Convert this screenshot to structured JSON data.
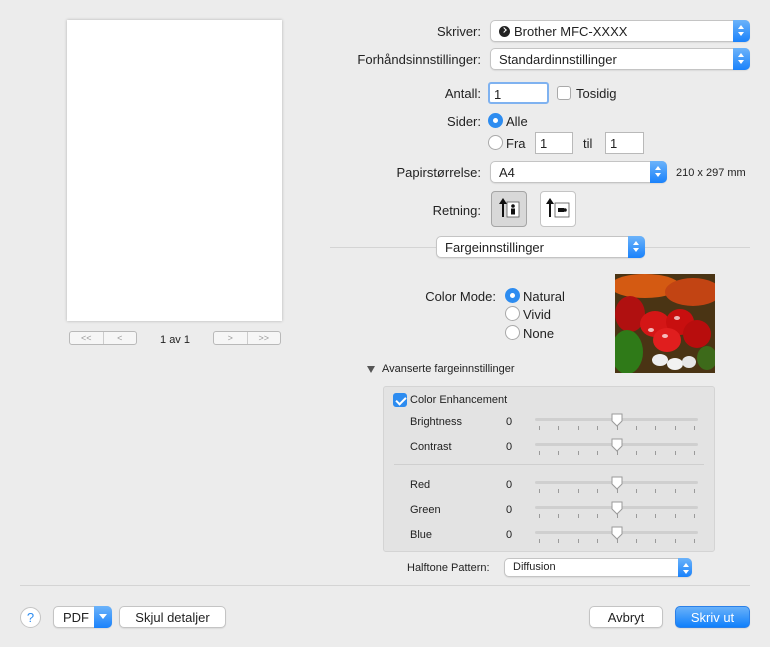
{
  "preview": {
    "page_indicator": "1 av 1",
    "first_label": "<<",
    "prev_label": "<",
    "next_label": ">",
    "last_label": ">>"
  },
  "printer": {
    "label": "Skriver:",
    "value": "Brother MFC-XXXX"
  },
  "presets": {
    "label": "Forhåndsinnstillinger:",
    "value": "Standardinnstillinger"
  },
  "copies": {
    "label": "Antall:",
    "value": "1",
    "two_sided_label": "Tosidig",
    "two_sided_checked": false
  },
  "pages": {
    "label": "Sider:",
    "all_label": "Alle",
    "from_label": "Fra",
    "from_value": "1",
    "to_label": "til",
    "to_value": "1",
    "selected": "all"
  },
  "paper": {
    "label": "Papirstørrelse:",
    "value": "A4",
    "dimensions": "210 x 297 mm"
  },
  "orientation": {
    "label": "Retning:",
    "options": [
      "portrait",
      "landscape"
    ],
    "selected": "portrait"
  },
  "section_popup": {
    "value": "Fargeinnstillinger"
  },
  "color_mode": {
    "label": "Color Mode:",
    "options": [
      "Natural",
      "Vivid",
      "None"
    ],
    "selected": "Natural"
  },
  "advanced": {
    "disclosure_label": "Avanserte fargeinnstillinger",
    "expanded": true,
    "enhancement_label": "Color Enhancement",
    "enhancement_checked": true,
    "sliders": [
      {
        "label": "Brightness",
        "value": "0",
        "position": 0.5
      },
      {
        "label": "Contrast",
        "value": "0",
        "position": 0.5
      },
      {
        "label": "Red",
        "value": "0",
        "position": 0.5
      },
      {
        "label": "Green",
        "value": "0",
        "position": 0.5
      },
      {
        "label": "Blue",
        "value": "0",
        "position": 0.5
      }
    ]
  },
  "halftone": {
    "label": "Halftone Pattern:",
    "value": "Diffusion"
  },
  "footer": {
    "help_label": "?",
    "pdf_label": "PDF",
    "hide_details_label": "Skjul detaljer",
    "cancel_label": "Avbryt",
    "print_label": "Skriv ut"
  },
  "colors": {
    "accent": "#2d8cf0",
    "background": "#ececec"
  }
}
